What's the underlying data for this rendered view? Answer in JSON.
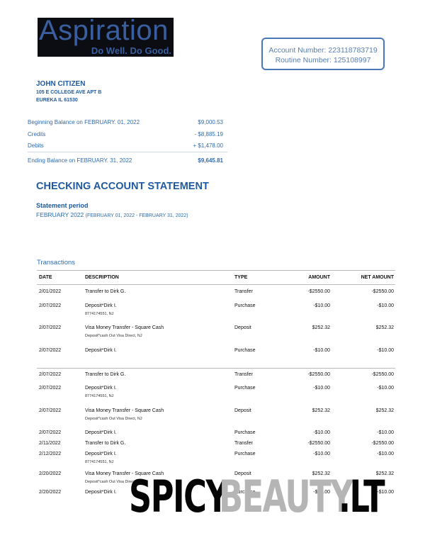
{
  "logo": {
    "word": "Aspiration",
    "tagline": "Do Well. Do Good."
  },
  "account": {
    "number_line": "Account Number: 223118783719",
    "routing_line": "Routine Number: 125108997"
  },
  "customer": {
    "name": "JOHN CITIZEN",
    "address1": "105 E COLLEGE AVE APT B",
    "address2": "EUREKA IL 61530"
  },
  "summary": {
    "beginning_label": "Beginning Balance on FEBRUARY. 01, 2022",
    "beginning_value": "$9,000.53",
    "credits_label": "Credits",
    "credits_value": "- $8,885.19",
    "debits_label": "Debits",
    "debits_value": "+ $1,478.00",
    "ending_label": "Ending Balance on FEBRUARY. 31, 2022",
    "ending_value": "$9,645.81"
  },
  "statement": {
    "title": "CHECKING ACCOUNT STATEMENT",
    "period_label": "Statement period",
    "period_month": "FEBRUARY 2022 ",
    "period_range": "(FEBRUARY 01, 2022 - FEBRUARY 31, 2022)"
  },
  "transactions": {
    "title": "Transactions",
    "headers": {
      "date": "DATE",
      "description": "DESCRIPTION",
      "type": "TYPE",
      "amount": "AMOUNT",
      "net": "NET AMOUNT"
    },
    "rows": [
      {
        "date": "2/01/2022",
        "desc": "Transfer to Dirk G.",
        "sub": "",
        "type": "Transfer",
        "amount": "-$2550.00",
        "net": "-$2550.00"
      },
      {
        "date": "2/07/2022",
        "desc": "Deposit*Dirk I.",
        "sub": "8774174551, NJ",
        "type": "Purchase",
        "amount": "-$10.00",
        "net": "-$10.00"
      },
      {
        "date": "2/07/2022",
        "desc": "Visa Money Transfer - Square Cash",
        "sub": "Deposit*cash Out Visa Direct, NJ",
        "type": "Deposit",
        "amount": "$252.32",
        "net": "$252.32"
      },
      {
        "date": "2/07/2022",
        "desc": "Deposit*Dirk I.",
        "sub": "",
        "type": "Purchase",
        "amount": "-$10.00",
        "net": "-$10.00"
      },
      {
        "date": "2/07/2022",
        "desc": "Transfer to Dirk G.",
        "sub": "",
        "type": "Transfer",
        "amount": "-$2550.00",
        "net": "-$2550.00"
      },
      {
        "date": "2/07/2022",
        "desc": "Deposit*Dirk I.",
        "sub": "8774174551, NJ",
        "type": "Purchase",
        "amount": "-$10.00",
        "net": "-$10.00"
      },
      {
        "date": "2/07/2022",
        "desc": "Visa Money Transfer - Square Cash",
        "sub": "Deposit*cash Out Visa Direct, NJ",
        "type": "Deposit",
        "amount": "$252.32",
        "net": "$252.32"
      },
      {
        "date": "2/07/2022",
        "desc": "Deposit*Dirk I.",
        "sub": "",
        "type": "Purchase",
        "amount": "-$10.00",
        "net": "-$10.00"
      },
      {
        "date": "2/11/2022",
        "desc": "Transfer to Dirk G.",
        "sub": "",
        "type": "Transfer",
        "amount": "-$2550.00",
        "net": "-$2550.00"
      },
      {
        "date": "2/12/2022",
        "desc": "Deposit*Dirk I.",
        "sub": "8774174551, NJ",
        "type": "Purchase",
        "amount": "-$10.00",
        "net": "-$10.00"
      },
      {
        "date": "2/20/2022",
        "desc": "Visa Money Transfer - Square Cash",
        "sub": "Deposit*cash Out Visa Direct, NJ",
        "type": "Deposit",
        "amount": "$252.32",
        "net": "$252.32"
      },
      {
        "date": "2/20/2022",
        "desc": "Deposit*Dirk I.",
        "sub": "",
        "type": "Purchase",
        "amount": "-$10.00",
        "net": "-$10.00"
      }
    ]
  },
  "watermark": {
    "part1": "SPICY",
    "part2": "BEAUTY",
    "part3": ".LT"
  }
}
